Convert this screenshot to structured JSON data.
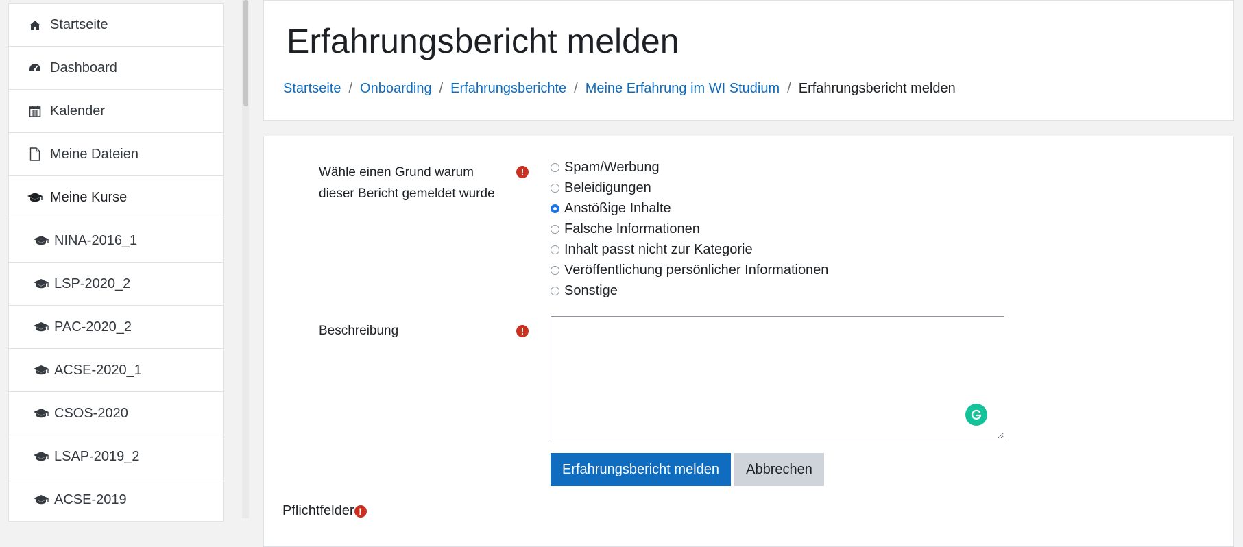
{
  "sidebar": {
    "items": [
      {
        "label": "Startseite",
        "icon": "home-icon"
      },
      {
        "label": "Dashboard",
        "icon": "dashboard-icon"
      },
      {
        "label": "Kalender",
        "icon": "calendar-icon"
      },
      {
        "label": "Meine Dateien",
        "icon": "file-icon"
      },
      {
        "label": "Meine Kurse",
        "icon": "graduation-cap-icon"
      }
    ],
    "courses": [
      {
        "label": "NINA-2016_1"
      },
      {
        "label": "LSP-2020_2"
      },
      {
        "label": "PAC-2020_2"
      },
      {
        "label": "ACSE-2020_1"
      },
      {
        "label": "CSOS-2020"
      },
      {
        "label": "LSAP-2019_2"
      },
      {
        "label": "ACSE-2019"
      }
    ]
  },
  "header": {
    "title": "Erfahrungsbericht melden",
    "breadcrumb": [
      "Startseite",
      "Onboarding",
      "Erfahrungsberichte",
      "Meine Erfahrung im WI Studium",
      "Erfahrungsbericht melden"
    ],
    "separator": "/"
  },
  "form": {
    "reason_label_line1": "Wähle einen Grund warum",
    "reason_label_line2": "dieser Bericht gemeldet wurde",
    "reasons": [
      {
        "label": "Spam/Werbung",
        "checked": false
      },
      {
        "label": "Beleidigungen",
        "checked": false
      },
      {
        "label": "Anstößige Inhalte",
        "checked": true
      },
      {
        "label": "Falsche Informationen",
        "checked": false
      },
      {
        "label": "Inhalt passt nicht zur Kategorie",
        "checked": false
      },
      {
        "label": "Veröffentlichung persönlicher Informationen",
        "checked": false
      },
      {
        "label": "Sonstige",
        "checked": false
      }
    ],
    "description_label": "Beschreibung",
    "description_value": "",
    "submit_label": "Erfahrungsbericht melden",
    "cancel_label": "Abbrechen",
    "required_note": "Pflichtfelder",
    "required_symbol": "!"
  },
  "colors": {
    "link": "#0f6cbf",
    "primary_button": "#0f6cbf",
    "required_icon": "#ca3120",
    "radio_checked": "#1a73e8",
    "grammarly": "#15c39a"
  }
}
